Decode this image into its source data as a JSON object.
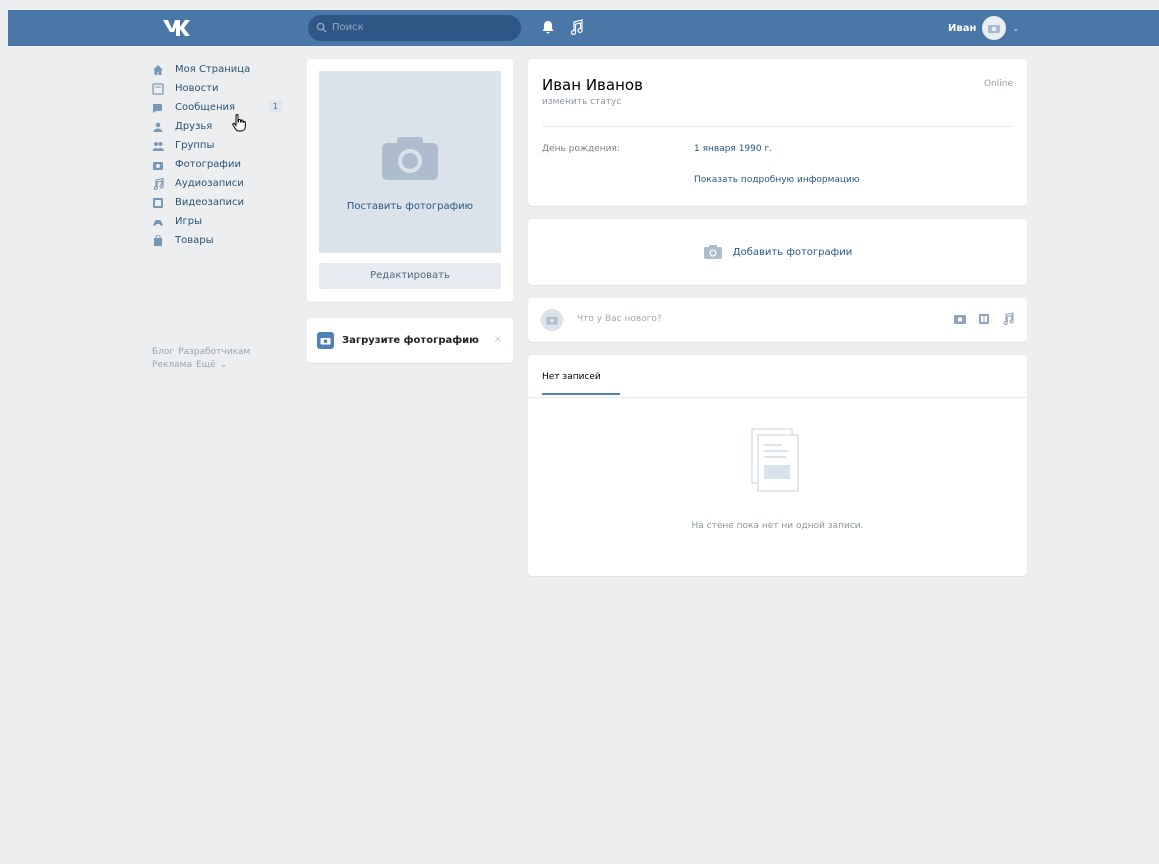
{
  "colors": {
    "header_bg": "#4a76a8",
    "page_bg": "#edeef0",
    "link": "#2a5885",
    "accent": "#5181b8"
  },
  "header": {
    "logo": "vk-logo",
    "search_placeholder": "Поиск",
    "icons": [
      "bell-icon",
      "music-icon"
    ],
    "user_name": "Иван"
  },
  "nav": {
    "items": [
      {
        "label": "Моя Страница",
        "icon": "home-icon"
      },
      {
        "label": "Новости",
        "icon": "news-icon"
      },
      {
        "label": "Сообщения",
        "icon": "messages-icon",
        "badge": "1"
      },
      {
        "label": "Друзья",
        "icon": "friends-icon"
      },
      {
        "label": "Группы",
        "icon": "groups-icon"
      },
      {
        "label": "Фотографии",
        "icon": "photos-icon"
      },
      {
        "label": "Аудиозаписи",
        "icon": "audio-icon"
      },
      {
        "label": "Видеозаписи",
        "icon": "video-icon"
      },
      {
        "label": "Игры",
        "icon": "games-icon"
      },
      {
        "label": "Товары",
        "icon": "goods-icon"
      }
    ],
    "footer": [
      "Блог",
      "Разработчикам",
      "Реклама",
      "Ещё"
    ]
  },
  "avatar": {
    "upload_label": "Поставить фотографию",
    "edit_label": "Редактировать"
  },
  "upload_prompt": {
    "label": "Загрузите фотографию",
    "close": "×"
  },
  "profile": {
    "name": "Иван Иванов",
    "status": "изменить статус",
    "online": "Online",
    "birthday_label": "День рождения:",
    "birthday_value": "1 января 1990 г.",
    "more_info": "Показать подробную информацию"
  },
  "photos": {
    "add_label": "Добавить фотографии"
  },
  "post": {
    "placeholder": "Что у Вас нового?"
  },
  "wall": {
    "tab": "Нет записей",
    "empty_text": "На стене пока нет ни одной записи."
  }
}
